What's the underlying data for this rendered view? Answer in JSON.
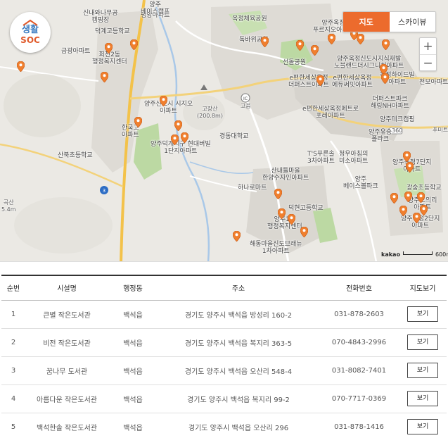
{
  "logo": {
    "line1": "생활",
    "line2": "SOC"
  },
  "map": {
    "type_control": {
      "map_label": "지도",
      "skyview_label": "스카이뷰"
    },
    "zoom": {
      "in_label": "+",
      "out_label": "−"
    },
    "scale": {
      "brand": "kakao",
      "distance": "600m"
    },
    "labels": {
      "l1": "신내와나무공\n캠핑장",
      "l2": "덕계고등학교",
      "l3": "금광아파트",
      "l4": "회천2동\n행정복지센터",
      "l5": "평양아파트",
      "l6": "양주\n베이스캠프",
      "l7": "옥정체육공원",
      "l8": "독바위공원",
      "l9": "양주옥정\n푸르지오아파트",
      "l10": "선돌공원",
      "l11": "양주옥정신도시지식재발\n노블랜드더시그니처아파트",
      "l12": "e편한세상옥정\n더퍼스트아파트",
      "l13": "e편한세상옥정\n에듀써밋아파트",
      "l14": "옥정하이드빌\n아파트",
      "l15": "천보아파트",
      "l16": "e편한세상옥정메트로\n포레아파트",
      "l17": "더퍼스트파크\n해링NH아파트",
      "l18": "양주테크캠핑",
      "l19": "양주유승\n폴라크",
      "l20": "양주신도시 시지오\n아파트",
      "l21": "고장산\n(200.8m)",
      "l22": "고읍",
      "l23": "한국고\n아파트",
      "l24": "양주덕계지구  현대버빌\n1단지아파트",
      "l25": "경동대학교",
      "l26": "산북초등학교",
      "l27": "T'S푸른솔\n3차아파트",
      "l28": "청우아침의\n미소아파트",
      "l29": "양주\n베이스볼파크",
      "l30": "양주옥정7단지\n아파트",
      "l31": "광숭초등학교",
      "l32": "산내들마을\n한양수자인아파트",
      "l33": "하나로마트",
      "l34": "덕현고등학교",
      "l35": "양주1동\n행정복지센터",
      "l36": "해동마을신도브래뉴\n1차아파트",
      "l37": "양주오의리\n아파트",
      "l38": "양주옥정2단지\n아파트",
      "l39": "곡산\n5.4m",
      "l40": "푸미트",
      "l41": "360"
    }
  },
  "table": {
    "headers": [
      "순번",
      "시설명",
      "행정동",
      "주소",
      "전화번호",
      "지도보기"
    ],
    "rows": [
      {
        "no": "1",
        "name": "큰별 작은도서관",
        "dong": "백석읍",
        "address": "경기도 양주시 백석읍 방성리 160-2",
        "phone": "031-878-2603",
        "btn": "보기"
      },
      {
        "no": "2",
        "name": "비전 작은도서관",
        "dong": "백석읍",
        "address": "경기도 양주시 백석읍 복지리 363-5",
        "phone": "070-4843-2996",
        "btn": "보기"
      },
      {
        "no": "3",
        "name": "꿈나무 도서관",
        "dong": "백석읍",
        "address": "경기도 양주시 백석읍 오산리 548-4",
        "phone": "031-8082-7401",
        "btn": "보기"
      },
      {
        "no": "4",
        "name": "아름다운 작은도서관",
        "dong": "백석읍",
        "address": "경기도 양주시 백석읍 복지리 99-2",
        "phone": "070-7717-0369",
        "btn": "보기"
      },
      {
        "no": "5",
        "name": "백석한솔 작은도서관",
        "dong": "백석읍",
        "address": "경기도 양주시 백석읍 오산리 296",
        "phone": "031-878-1416",
        "btn": "보기"
      }
    ]
  },
  "colors": {
    "accent": "#ec6b2d",
    "pin": "#f07f2e",
    "park": "#bcd9a3",
    "water": "#a9c8e8",
    "urban": "#d9d6d0"
  }
}
